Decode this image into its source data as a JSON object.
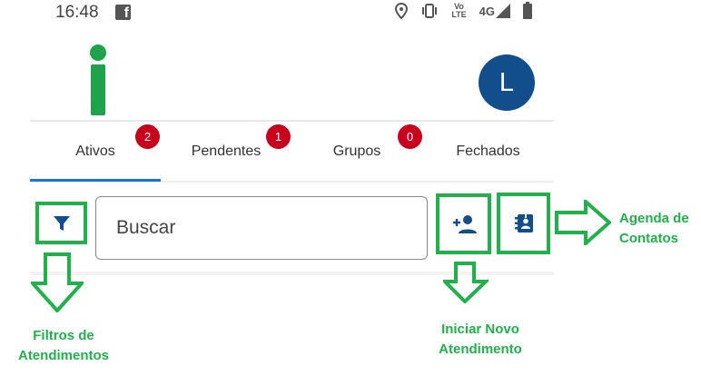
{
  "status_bar": {
    "time": "16:48",
    "volte_top": "Vo",
    "volte_bottom": "LTE",
    "network": "4G"
  },
  "header": {
    "avatar_letter": "L"
  },
  "tabs": [
    {
      "label": "Ativos",
      "badge": "2"
    },
    {
      "label": "Pendentes",
      "badge": "1"
    },
    {
      "label": "Grupos",
      "badge": "0"
    },
    {
      "label": "Fechados"
    }
  ],
  "search": {
    "placeholder": "Buscar"
  },
  "annotations": {
    "filtros": "Filtros de Atendimentos",
    "novo": "Iniciar Novo Atendimento",
    "agenda": "Agenda de Contatos"
  },
  "colors": {
    "accent": "#1976d2",
    "brand_green": "#1ea34a",
    "annotation_green": "#22b04b",
    "badge_red": "#c8001e",
    "avatar_blue": "#124e8c",
    "icon_blue": "#124e8c"
  },
  "icons": {
    "filter": "filter-icon",
    "add_person": "person-add-icon",
    "contacts_book": "contacts-book-icon"
  }
}
